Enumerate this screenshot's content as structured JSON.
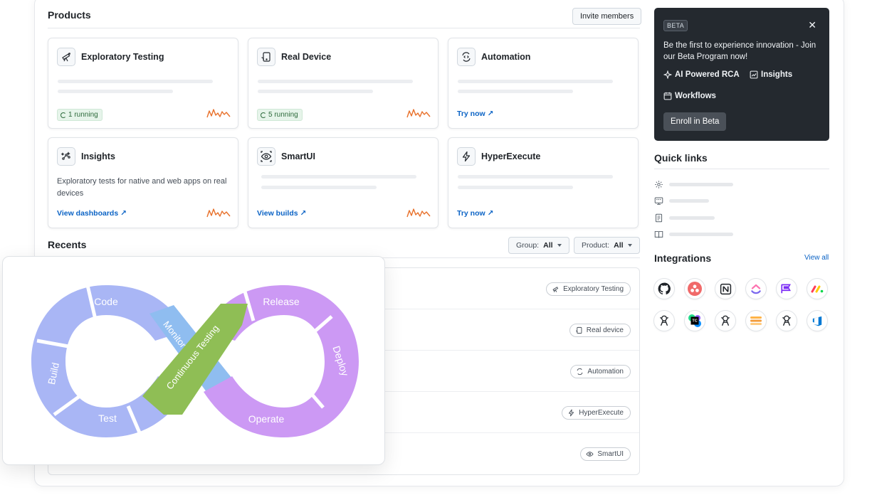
{
  "products": {
    "title": "Products",
    "invite_label": "Invite members",
    "cards": [
      {
        "title": "Exploratory Testing",
        "icon": "telescope-icon",
        "status": "1 running"
      },
      {
        "title": "Real Device",
        "icon": "device-icon",
        "status": "5 running"
      },
      {
        "title": "Automation",
        "icon": "automation-icon",
        "link": "Try now ↗"
      },
      {
        "title": "Insights",
        "icon": "insights-icon",
        "description": "Exploratory tests for native and web apps on real devices",
        "link": "View dashboards ↗"
      },
      {
        "title": "SmartUI",
        "icon": "eye-icon",
        "link": "View builds ↗"
      },
      {
        "title": "HyperExecute",
        "icon": "lightning-icon",
        "link": "Try now ↗"
      }
    ]
  },
  "recents": {
    "title": "Recents",
    "group_label": "Group:",
    "group_value": "All",
    "product_label": "Product:",
    "product_value": "All",
    "rows": [
      {
        "tag": "Exploratory Testing"
      },
      {
        "tag": "Real device"
      },
      {
        "tag": "Automation"
      },
      {
        "tag": "HyperExecute"
      },
      {
        "tag": "SmartUI"
      }
    ]
  },
  "beta": {
    "badge": "BETA",
    "close": "✕",
    "text": "Be the first to experience innovation - Join our Beta Program now!",
    "features": [
      "AI Powered RCA",
      "Insights",
      "Workflows"
    ],
    "enroll_label": "Enroll in Beta"
  },
  "quick_links": {
    "title": "Quick links",
    "icons": [
      "gear-icon",
      "api-icon",
      "docs-icon",
      "book-icon"
    ]
  },
  "integrations": {
    "title": "Integrations",
    "view_all": "View all",
    "items": [
      "github-icon",
      "asana-icon",
      "notion-icon",
      "clickup-icon",
      "flag-icon",
      "monday-icon",
      "jenkins-icon",
      "teamcity-icon",
      "jenkins-icon",
      "stack-icon",
      "jenkins-icon",
      "azure-icon"
    ]
  },
  "devops_diagram": {
    "stages": [
      "Code",
      "Build",
      "Test",
      "Release",
      "Deploy",
      "Operate",
      "Monitor"
    ],
    "center_label": "Continuous Testing",
    "colors": {
      "left": "#a9b6f5",
      "right": "#cc99f4",
      "center": "#8fbe55",
      "monitor": "#8fbdf0"
    }
  }
}
